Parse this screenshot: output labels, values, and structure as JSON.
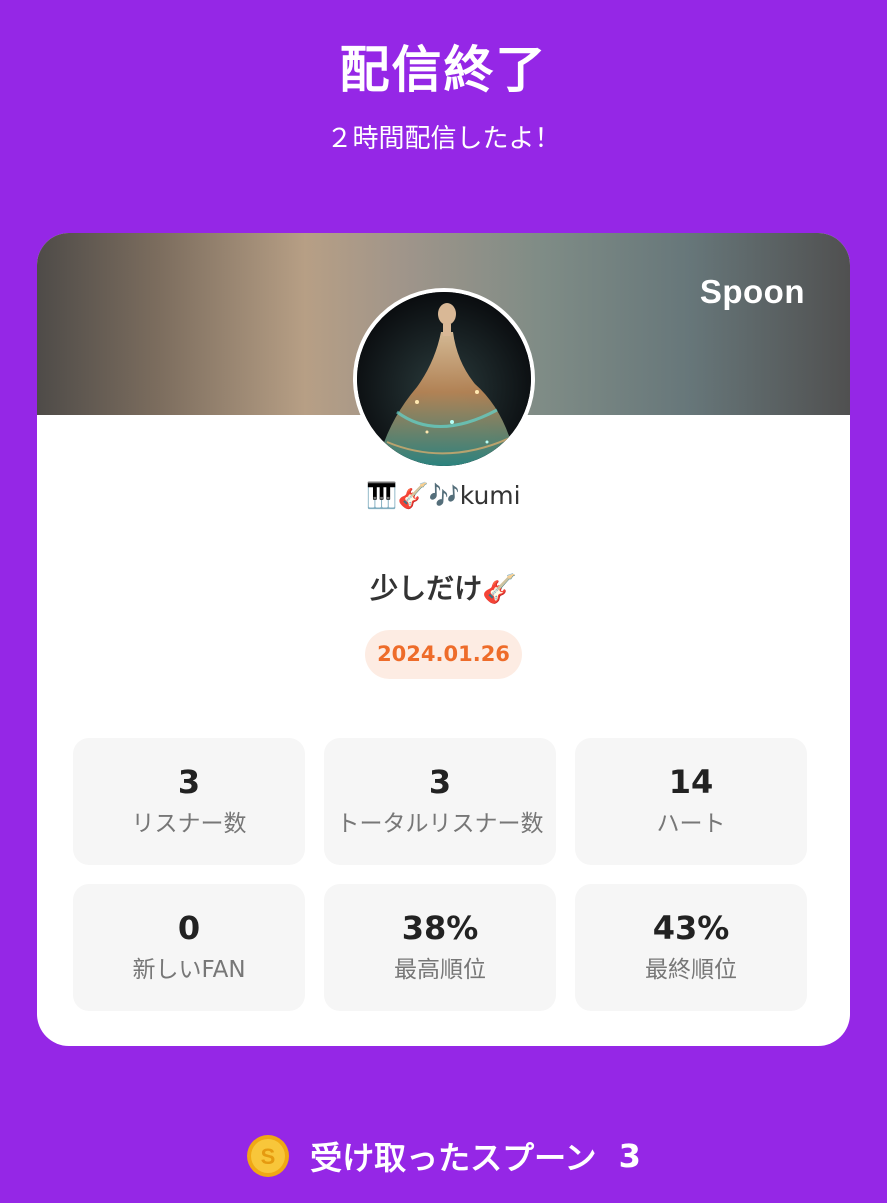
{
  "header": {
    "title": "配信終了",
    "subtitle": "２時間配信したよ！"
  },
  "card": {
    "brand": "Spoon",
    "username": "🎹🎸🎶kumi",
    "broadcast_title": "少しだけ🎸",
    "date": "2024.01.26",
    "stats": [
      {
        "value": "3",
        "label": "リスナー数"
      },
      {
        "value": "3",
        "label": "トータルリスナー数"
      },
      {
        "value": "14",
        "label": "ハート"
      },
      {
        "value": "0",
        "label": "新しいFAN"
      },
      {
        "value": "38%",
        "label": "最高順位"
      },
      {
        "value": "43%",
        "label": "最終順位"
      }
    ]
  },
  "footer": {
    "label": "受け取ったスプーン",
    "count": "3",
    "coin_icon": "spoon-coin-icon",
    "coin_glyph": "S"
  },
  "colors": {
    "background": "#9527e6",
    "date_text": "#ee6c2a",
    "date_bg": "#fdece3",
    "coin": "#f5b91f"
  }
}
